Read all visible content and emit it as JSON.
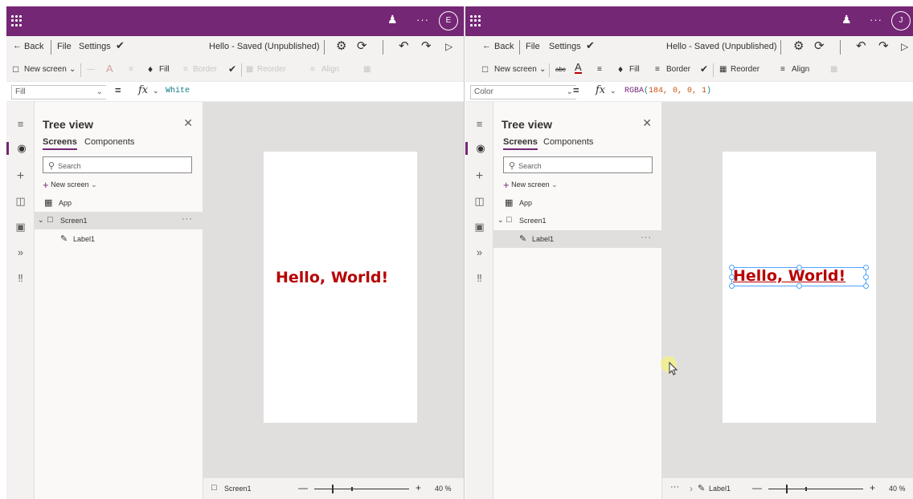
{
  "colors": {
    "appbar": "#742774",
    "label_text": "#b80000",
    "selection": "#4da3ff"
  },
  "panes": [
    {
      "id": "left",
      "avatar_initial": "E",
      "command_bar": {
        "back": "Back",
        "file": "File",
        "settings": "Settings",
        "doc_status": "Hello - Saved (Unpublished)"
      },
      "ribbon": {
        "new_screen": "New screen",
        "fill": "Fill",
        "border": "Border",
        "reorder": "Reorder",
        "align": "Align"
      },
      "formula": {
        "property": "Fill",
        "value": "White"
      },
      "tree": {
        "title": "Tree view",
        "tabs": [
          "Screens",
          "Components"
        ],
        "search_placeholder": "Search",
        "new_screen": "New screen",
        "items": [
          {
            "label": "App"
          },
          {
            "label": "Screen1"
          },
          {
            "label": "Label1"
          }
        ]
      },
      "canvas_label": "Hello, World!",
      "status": {
        "selection": "Screen1",
        "zoom": "40 %"
      }
    },
    {
      "id": "right",
      "avatar_initial": "J",
      "command_bar": {
        "back": "Back",
        "file": "File",
        "settings": "Settings",
        "doc_status": "Hello - Saved (Unpublished)"
      },
      "ribbon": {
        "new_screen": "New screen",
        "fill": "Fill",
        "border": "Border",
        "reorder": "Reorder",
        "align": "Align"
      },
      "formula": {
        "property": "Color",
        "fn": "RGBA",
        "args": "184, 0, 0, 1"
      },
      "tree": {
        "title": "Tree view",
        "tabs": [
          "Screens",
          "Components"
        ],
        "search_placeholder": "Search",
        "new_screen": "New screen",
        "items": [
          {
            "label": "App"
          },
          {
            "label": "Screen1"
          },
          {
            "label": "Label1"
          }
        ]
      },
      "canvas_label": "Hello, World!",
      "status": {
        "breadcrumb_more": "···",
        "selection": "Label1",
        "zoom": "40 %"
      }
    }
  ]
}
